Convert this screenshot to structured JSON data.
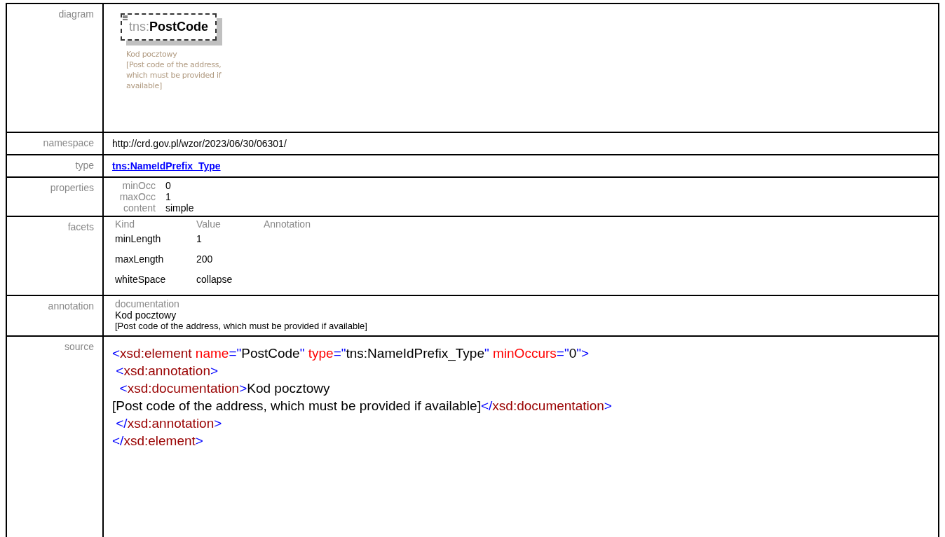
{
  "rows": [
    {
      "kind": "diagram",
      "label": "diagram",
      "prefix": "tns:",
      "name": "PostCode",
      "note_lines": [
        "Kod pocztowy",
        "[Post code of the address,",
        "which must be provided if",
        "available]"
      ]
    },
    {
      "kind": "text",
      "label": "namespace",
      "value": "http://crd.gov.pl/wzor/2023/06/30/06301/"
    },
    {
      "kind": "link",
      "label": "type",
      "value": "tns:NameIdPrefix_Type"
    },
    {
      "kind": "props",
      "label": "properties",
      "items": [
        {
          "key": "minOcc",
          "value": "0"
        },
        {
          "key": "maxOcc",
          "value": "1"
        },
        {
          "key": "content",
          "value": "simple"
        }
      ]
    },
    {
      "kind": "facets",
      "label": "facets",
      "columns": [
        "Kind",
        "Value",
        "Annotation"
      ],
      "items": [
        {
          "kind": "minLength",
          "value": "1"
        },
        {
          "kind": "maxLength",
          "value": "200"
        },
        {
          "kind": "whiteSpace",
          "value": "collapse"
        }
      ]
    },
    {
      "kind": "annotation",
      "label": "annotation",
      "heading": "documentation",
      "lines": [
        "Kod pocztowy",
        "[Post code of the address, which must be provided if available]"
      ]
    },
    {
      "kind": "source",
      "label": "source",
      "lines": [
        [
          {
            "kind": "punct",
            "text": "<"
          },
          {
            "kind": "name",
            "text": "xsd:element"
          },
          {
            "kind": "attr",
            "text": " name"
          },
          {
            "kind": "punct",
            "text": "=\""
          },
          {
            "kind": "text",
            "text": "PostCode"
          },
          {
            "kind": "punct",
            "text": "\""
          },
          {
            "kind": "attr",
            "text": " type"
          },
          {
            "kind": "punct",
            "text": "=\""
          },
          {
            "kind": "text",
            "text": "tns:NameIdPrefix_Type"
          },
          {
            "kind": "punct",
            "text": "\""
          },
          {
            "kind": "attr",
            "text": " minOccurs"
          },
          {
            "kind": "punct",
            "text": "=\""
          },
          {
            "kind": "text",
            "text": "0"
          },
          {
            "kind": "punct",
            "text": "\">"
          }
        ],
        [
          {
            "kind": "punct",
            "text": " <"
          },
          {
            "kind": "name",
            "text": "xsd:annotation"
          },
          {
            "kind": "punct",
            "text": ">"
          }
        ],
        [
          {
            "kind": "punct",
            "text": "  <"
          },
          {
            "kind": "name",
            "text": "xsd:documentation"
          },
          {
            "kind": "punct",
            "text": ">"
          },
          {
            "kind": "text",
            "text": "Kod pocztowy"
          }
        ],
        [
          {
            "kind": "text",
            "text": "[Post code of the address, which must be provided if available]"
          },
          {
            "kind": "punct",
            "text": "</"
          },
          {
            "kind": "name",
            "text": "xsd:documentation"
          },
          {
            "kind": "punct",
            "text": ">"
          }
        ],
        [
          {
            "kind": "punct",
            "text": " </"
          },
          {
            "kind": "name",
            "text": "xsd:annotation"
          },
          {
            "kind": "punct",
            "text": ">"
          }
        ],
        [
          {
            "kind": "punct",
            "text": "</"
          },
          {
            "kind": "name",
            "text": "xsd:element"
          },
          {
            "kind": "punct",
            "text": ">"
          }
        ]
      ]
    }
  ]
}
